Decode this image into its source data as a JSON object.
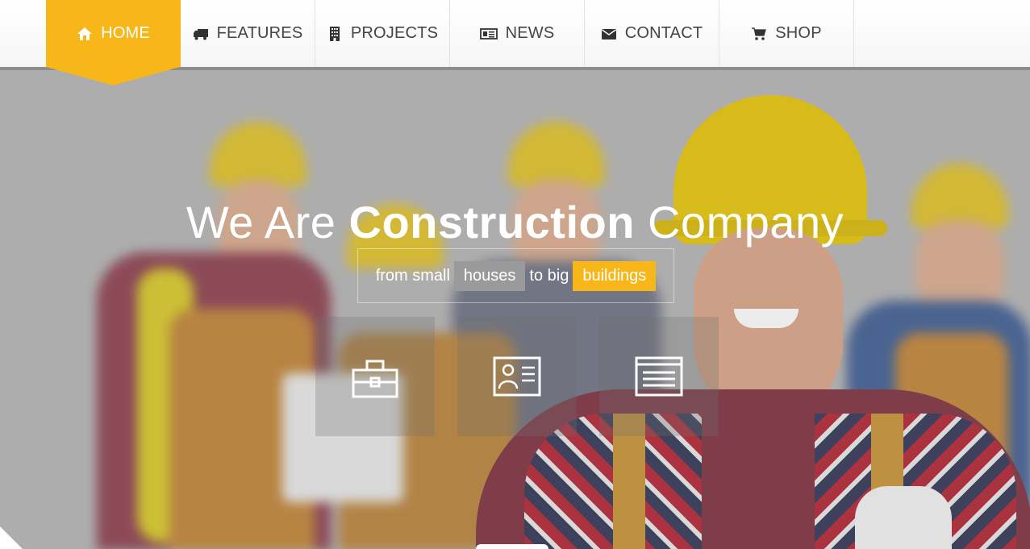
{
  "nav": {
    "items": [
      {
        "label": "HOME",
        "icon": "home-icon",
        "active": true
      },
      {
        "label": "FEATURES",
        "icon": "truck-icon",
        "active": false
      },
      {
        "label": "PROJECTS",
        "icon": "building-icon",
        "active": false
      },
      {
        "label": "NEWS",
        "icon": "newspaper-icon",
        "active": false
      },
      {
        "label": "CONTACT",
        "icon": "envelope-icon",
        "active": false
      },
      {
        "label": "SHOP",
        "icon": "cart-icon",
        "active": false
      }
    ],
    "accent": "#f7b718"
  },
  "hero": {
    "title_pre": "We Are ",
    "title_bold": "Construction",
    "title_post": " Company",
    "tagline": {
      "part1": "from small",
      "highlight1": "houses",
      "part2": "to big",
      "highlight2": "buildings"
    },
    "feature_icons": [
      "toolbox-icon",
      "id-card-icon",
      "document-list-icon"
    ]
  }
}
